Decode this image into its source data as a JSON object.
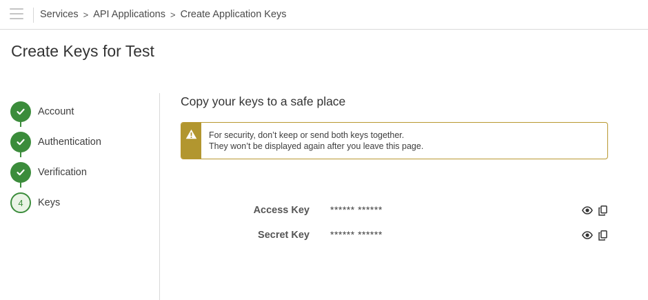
{
  "breadcrumb": {
    "items": [
      "Services",
      "API Applications",
      "Create Application Keys"
    ],
    "separator": ">"
  },
  "page": {
    "title": "Create Keys for Test"
  },
  "steps": [
    {
      "label": "Account",
      "status": "done"
    },
    {
      "label": "Authentication",
      "status": "done"
    },
    {
      "label": "Verification",
      "status": "done"
    },
    {
      "label": "Keys",
      "status": "current",
      "number": "4"
    }
  ],
  "section": {
    "title": "Copy your keys to a safe place"
  },
  "alert": {
    "icon": "warning-icon",
    "line1": "For security, don’t keep or send both keys together.",
    "line2": "They won’t be displayed again after you leave this page."
  },
  "keys": [
    {
      "label": "Access Key",
      "value": "****** ******",
      "actions": [
        "eye-icon",
        "copy-icon"
      ]
    },
    {
      "label": "Secret Key",
      "value": "****** ******",
      "actions": [
        "eye-icon",
        "copy-icon"
      ]
    }
  ],
  "colors": {
    "accent_green": "#3b8c3b",
    "warning": "#b2962f"
  }
}
